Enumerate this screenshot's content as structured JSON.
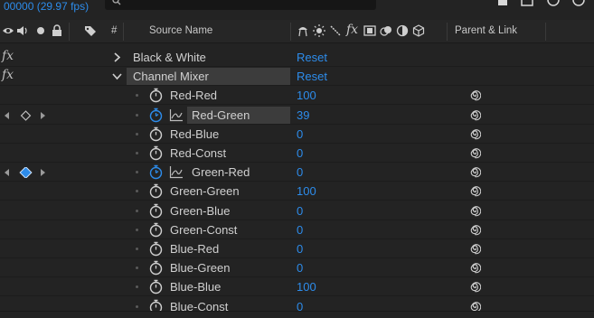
{
  "timecode": "00000 (29.97 fps)",
  "header": {
    "source_name": "Source Name",
    "hash": "#",
    "parent_link": "Parent & Link"
  },
  "rows": [
    {
      "type": "effect",
      "name": "Black & White",
      "value": "Reset",
      "expanded": false
    },
    {
      "type": "effect",
      "name": "Channel Mixer",
      "value": "Reset",
      "expanded": true
    },
    {
      "type": "prop",
      "name": "Red-Red",
      "value": "100",
      "stopwatch_active": false
    },
    {
      "type": "prop",
      "name": "Red-Green",
      "value": "39",
      "stopwatch_active": true,
      "keyframed": true,
      "selected": true
    },
    {
      "type": "prop",
      "name": "Red-Blue",
      "value": "0",
      "stopwatch_active": false
    },
    {
      "type": "prop",
      "name": "Red-Const",
      "value": "0",
      "stopwatch_active": false
    },
    {
      "type": "prop",
      "name": "Green-Red",
      "value": "0",
      "stopwatch_active": true,
      "keyframed": true,
      "keyframe_on": true
    },
    {
      "type": "prop",
      "name": "Green-Green",
      "value": "100",
      "stopwatch_active": false
    },
    {
      "type": "prop",
      "name": "Green-Blue",
      "value": "0",
      "stopwatch_active": false
    },
    {
      "type": "prop",
      "name": "Green-Const",
      "value": "0",
      "stopwatch_active": false
    },
    {
      "type": "prop",
      "name": "Blue-Red",
      "value": "0",
      "stopwatch_active": false
    },
    {
      "type": "prop",
      "name": "Blue-Green",
      "value": "0",
      "stopwatch_active": false
    },
    {
      "type": "prop",
      "name": "Blue-Blue",
      "value": "100",
      "stopwatch_active": false
    },
    {
      "type": "prop",
      "name": "Blue-Const",
      "value": "0",
      "stopwatch_active": false
    }
  ],
  "colors": {
    "accent": "#2d8ceb",
    "bg": "#232323",
    "keyframe": "#2d8ceb"
  }
}
